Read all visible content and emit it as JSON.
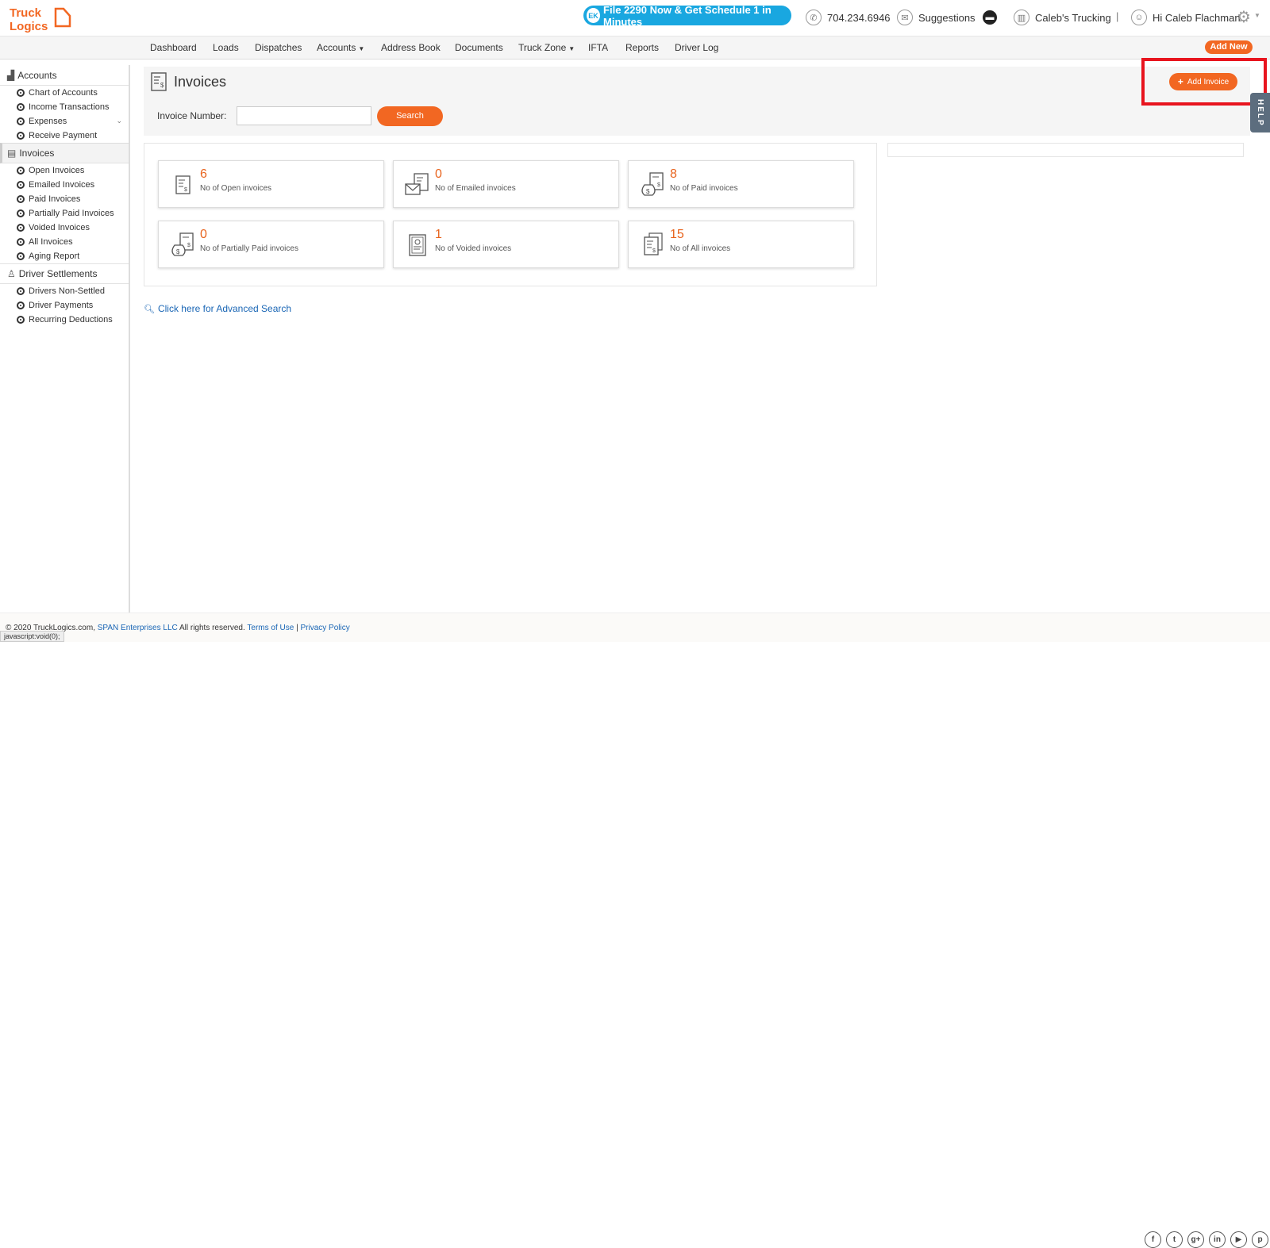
{
  "header": {
    "promo": "File 2290 Now & Get Schedule 1 in Minutes",
    "promo_badge": "EK",
    "phone": "704.234.6946",
    "suggestions": "Suggestions",
    "company": "Caleb's Trucking",
    "separator": "|",
    "greeting": "Hi Caleb Flachman"
  },
  "nav": {
    "items": [
      "Dashboard",
      "Loads",
      "Dispatches",
      "Accounts",
      "Address Book",
      "Documents",
      "Truck Zone",
      "IFTA",
      "Reports",
      "Driver Log"
    ],
    "add_new": "Add New"
  },
  "sidebar": {
    "accounts": "Accounts",
    "accounts_items": [
      "Chart of Accounts",
      "Income Transactions",
      "Expenses",
      "Receive Payment"
    ],
    "invoices": "Invoices",
    "invoices_items": [
      "Open Invoices",
      "Emailed Invoices",
      "Paid Invoices",
      "Partially Paid Invoices",
      "Voided Invoices",
      "All Invoices",
      "Aging Report"
    ],
    "settlements": "Driver Settlements",
    "settlements_items": [
      "Drivers Non-Settled",
      "Driver Payments",
      "Recurring Deductions"
    ]
  },
  "main": {
    "title": "Invoices",
    "invoice_number_label": "Invoice Number:",
    "invoice_number_value": "",
    "search_button": "Search",
    "add_invoice_button": "Add Invoice",
    "help_tab": "HELP",
    "advanced_search": "Click here for Advanced Search"
  },
  "stats": [
    {
      "value": "6",
      "label": "No of Open invoices",
      "icon": "invoice-doc-icon"
    },
    {
      "value": "0",
      "label": "No of Emailed invoices",
      "icon": "invoice-email-icon"
    },
    {
      "value": "8",
      "label": "No of Paid invoices",
      "icon": "invoice-money-bag-icon"
    },
    {
      "value": "0",
      "label": "No of Partially Paid invoices",
      "icon": "invoice-money-bag-icon"
    },
    {
      "value": "1",
      "label": "No of Voided invoices",
      "icon": "invoice-void-icon"
    },
    {
      "value": "15",
      "label": "No of All invoices",
      "icon": "invoice-stack-icon"
    }
  ],
  "footer": {
    "copyright": "© 2020 TruckLogics.com,",
    "company_link": "SPAN Enterprises LLC",
    "rights": "All rights reserved.",
    "terms": "Terms of Use",
    "divider": "|",
    "privacy": "Privacy Policy",
    "status_url": "javascript:void(0);"
  },
  "colors": {
    "accent": "#f26722",
    "promo": "#19a7e0",
    "link": "#1a66b5",
    "highlight": "#e8141e"
  }
}
